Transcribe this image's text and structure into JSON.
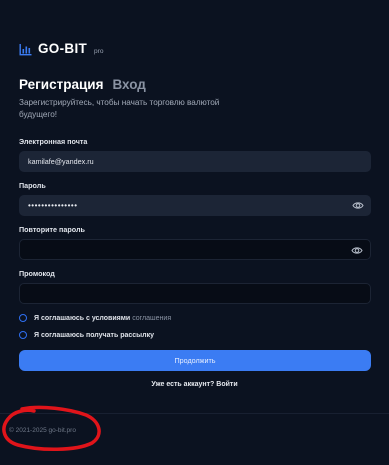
{
  "brand": {
    "name": "GO-BIT",
    "suffix": "pro",
    "icon": "bar-chart-icon",
    "accent": "#3b7cf3"
  },
  "tabs": [
    {
      "label": "Регистрация",
      "active": true
    },
    {
      "label": "Вход",
      "active": false
    }
  ],
  "subtitle": "Зарегистрируйтесь, чтобы начать торговлю валютой будущего!",
  "fields": {
    "email": {
      "label": "Электронная почта",
      "value": "kamilafe@yandex.ru"
    },
    "password": {
      "label": "Пароль",
      "value": "•••••••••••••••"
    },
    "confirm": {
      "label": "Повторите пароль",
      "value": ""
    },
    "promo": {
      "label": "Промокод",
      "value": ""
    }
  },
  "checks": {
    "terms": {
      "text": "Я соглашаюсь с условиями",
      "link": "соглашения",
      "checked": false
    },
    "newsletter": {
      "text": "Я соглашаюсь получать рассылку",
      "checked": false
    }
  },
  "submit_label": "Продолжить",
  "login_prompt": {
    "text": "Уже есть аккаунт?",
    "link": "Войти"
  },
  "footer": {
    "copyright": "© 2021-2025 go-bit.pro"
  },
  "annotation_color": "#e0141a"
}
